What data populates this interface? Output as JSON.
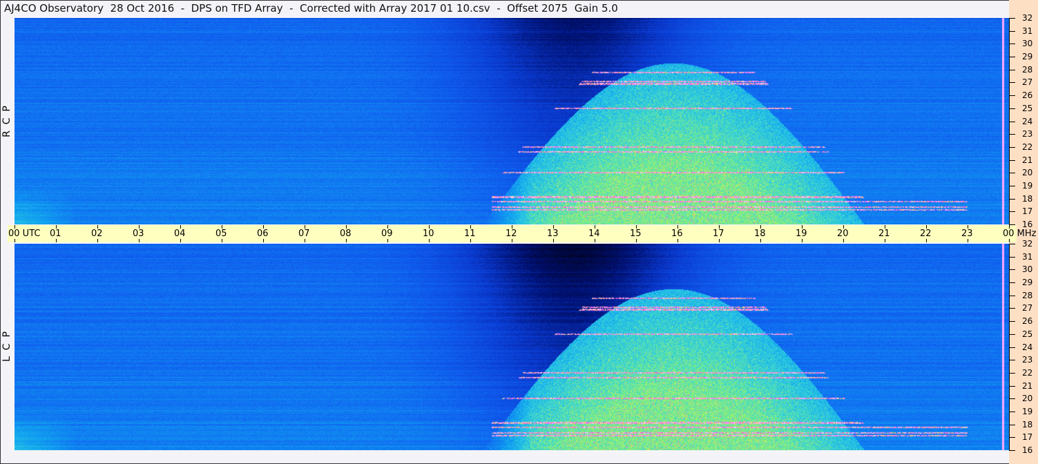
{
  "title": "AJ4CO Observatory  28 Oct 2016  -  DPS on TFD Array  -  Corrected with Array 2017 01 10.csv  -  Offset 2075  Gain 5.0",
  "chart_data": {
    "type": "heatmap",
    "title": "AJ4CO Observatory  28 Oct 2016  -  DPS on TFD Array  -  Corrected with Array 2017 01 10.csv  -  Offset 2075  Gain 5.0",
    "xlabel": "UTC",
    "ylabel": "MHz",
    "xlim": [
      0,
      24
    ],
    "ylim": [
      16,
      32
    ],
    "x_ticks": [
      "00 UTC",
      "01",
      "02",
      "03",
      "04",
      "05",
      "06",
      "07",
      "08",
      "09",
      "10",
      "11",
      "12",
      "13",
      "14",
      "15",
      "16",
      "17",
      "18",
      "19",
      "20",
      "21",
      "22",
      "23",
      "00 MHz"
    ],
    "y_ticks": [
      "32",
      "31",
      "30",
      "29",
      "28",
      "27",
      "26",
      "25",
      "24",
      "23",
      "22",
      "21",
      "20",
      "19",
      "18",
      "17",
      "16"
    ],
    "panels": [
      {
        "name": "RCP",
        "label": "R  C  P"
      },
      {
        "name": "LCP",
        "label": "L  C  P"
      }
    ],
    "colormap": [
      "#000010",
      "#001070",
      "#0a3ad0",
      "#1060f0",
      "#10a0f0",
      "#30d0e0",
      "#80f080",
      "#f0f040",
      "#ff40ff",
      "#ffffff"
    ]
  }
}
